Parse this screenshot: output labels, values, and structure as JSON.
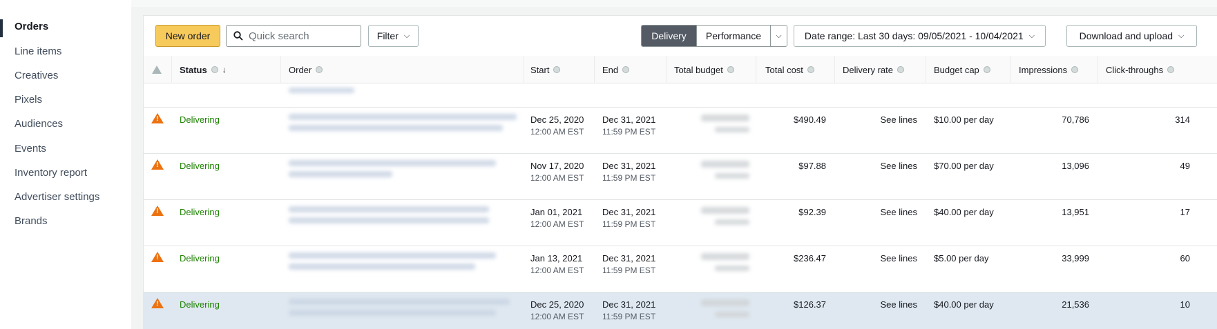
{
  "sidebar": {
    "items": [
      {
        "label": "Orders",
        "active": true
      },
      {
        "label": "Line items"
      },
      {
        "label": "Creatives"
      },
      {
        "label": "Pixels"
      },
      {
        "label": "Audiences"
      },
      {
        "label": "Events"
      },
      {
        "label": "Inventory report"
      },
      {
        "label": "Advertiser settings"
      },
      {
        "label": "Brands"
      }
    ]
  },
  "toolbar": {
    "new_order_label": "New order",
    "search_placeholder": "Quick search",
    "filter_label": "Filter",
    "view_delivery": "Delivery",
    "view_performance": "Performance",
    "date_range_label": "Date range:  Last 30 days: 09/05/2021 - 10/04/2021",
    "download_label": "Download and upload"
  },
  "table": {
    "columns": [
      "Status",
      "Order",
      "Start",
      "End",
      "Total budget",
      "Total cost",
      "Delivery rate",
      "Budget cap",
      "Impressions",
      "Click-throughs"
    ],
    "rows": [
      {
        "status": "Delivering",
        "start_date": "Dec 25, 2020",
        "start_time": "12:00 AM EST",
        "end_date": "Dec 31, 2021",
        "end_time": "11:59 PM EST",
        "total_cost": "$490.49",
        "delivery_rate": "See lines",
        "budget_cap": "$10.00 per day",
        "impressions": "70,786",
        "clicks": "314"
      },
      {
        "status": "Delivering",
        "start_date": "Nov 17, 2020",
        "start_time": "12:00 AM EST",
        "end_date": "Dec 31, 2021",
        "end_time": "11:59 PM EST",
        "total_cost": "$97.88",
        "delivery_rate": "See lines",
        "budget_cap": "$70.00 per day",
        "impressions": "13,096",
        "clicks": "49"
      },
      {
        "status": "Delivering",
        "start_date": "Jan 01, 2021",
        "start_time": "12:00 AM EST",
        "end_date": "Dec 31, 2021",
        "end_time": "11:59 PM EST",
        "total_cost": "$92.39",
        "delivery_rate": "See lines",
        "budget_cap": "$40.00 per day",
        "impressions": "13,951",
        "clicks": "17"
      },
      {
        "status": "Delivering",
        "start_date": "Jan 13, 2021",
        "start_time": "12:00 AM EST",
        "end_date": "Dec 31, 2021",
        "end_time": "11:59 PM EST",
        "total_cost": "$236.47",
        "delivery_rate": "See lines",
        "budget_cap": "$5.00 per day",
        "impressions": "33,999",
        "clicks": "60"
      },
      {
        "status": "Delivering",
        "start_date": "Dec 25, 2020",
        "start_time": "12:00 AM EST",
        "end_date": "Dec 31, 2021",
        "end_time": "11:59 PM EST",
        "total_cost": "$126.37",
        "delivery_rate": "See lines",
        "budget_cap": "$40.00 per day",
        "impressions": "21,536",
        "clicks": "10",
        "selected": true
      }
    ]
  },
  "colors": {
    "primary_button": "#f7ca5c",
    "status_green": "#1d8102",
    "warning_orange": "#ec7211",
    "selected_row": "#dfe8f0"
  }
}
